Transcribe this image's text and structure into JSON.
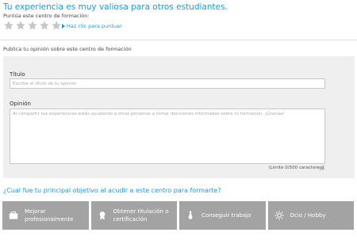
{
  "header": {
    "headline": "Tu experiencia es muy valiosa para otros estudiantes.",
    "rate_label": "Puntúa este centro de formación:",
    "stars": {
      "count": 5,
      "selected": 0,
      "color": "#c6c6c6"
    },
    "rate_link": "Haz clic para puntuar"
  },
  "opinion": {
    "heading": "Publica tu opinión sobre este centro de formación",
    "title_label": "Título",
    "title_placeholder": "Escribe el título de tu opinión",
    "opinion_label": "Opinión",
    "opinion_placeholder": "Al compartir tus experiencias estás ayudando a otras personas a tomar decisiones informadas sobre tu formación. ¡Gracias!",
    "limit_text": "(Límite 0/500 caracteres)"
  },
  "goals": {
    "question": "¿Cual fue tu principal objetivo al acudir a este centro para formarte?",
    "options": [
      {
        "label_line1": "Mejorar",
        "label_line2": "profesionalmente",
        "icon": "briefcase-icon"
      },
      {
        "label_line1": "Obtener titulación o",
        "label_line2": "certificación",
        "icon": "diploma-icon"
      },
      {
        "label_line1": "Conseguir trabajo",
        "label_line2": "",
        "icon": "tie-icon"
      },
      {
        "label_line1": "Ocio / Hobby",
        "label_line2": "",
        "icon": "sun-icon"
      }
    ]
  },
  "colors": {
    "accent": "#1a9ad6",
    "panel": "#efefef",
    "goal_button": "#a3a3a3"
  }
}
